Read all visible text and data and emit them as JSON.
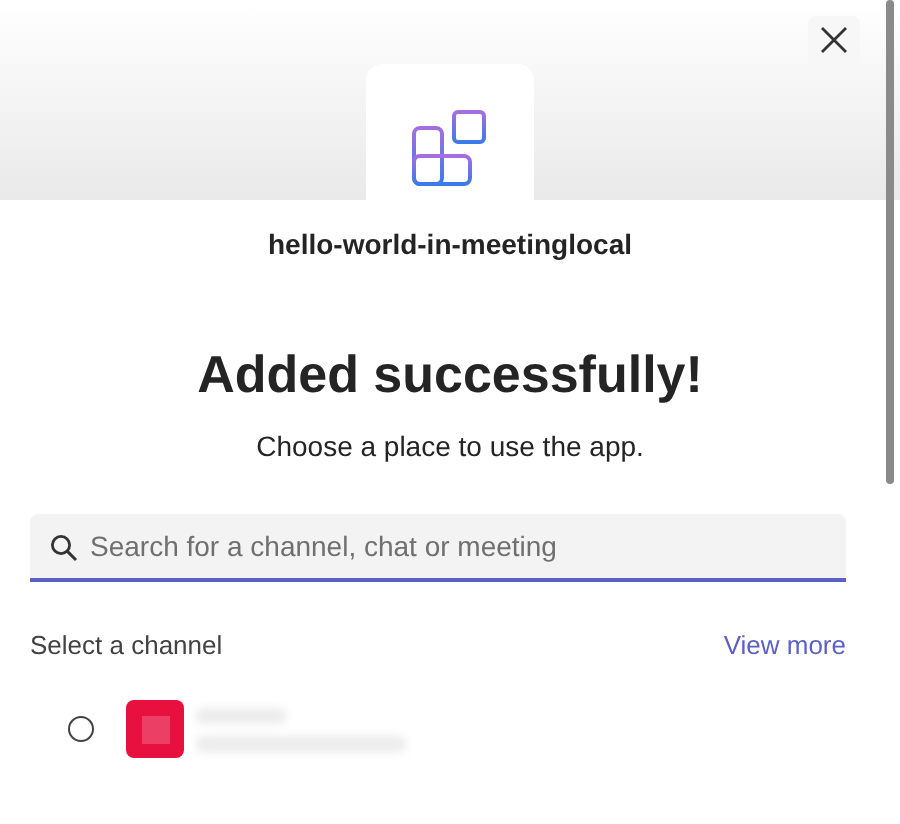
{
  "app": {
    "name": "hello-world-in-meetinglocal"
  },
  "heading": "Added successfully!",
  "subtitle": "Choose a place to use the app.",
  "search": {
    "placeholder": "Search for a channel, chat or meeting"
  },
  "section": {
    "label": "Select a channel",
    "link": "View more"
  },
  "channels": [
    {
      "selected": false,
      "color": "#e8103f"
    }
  ]
}
